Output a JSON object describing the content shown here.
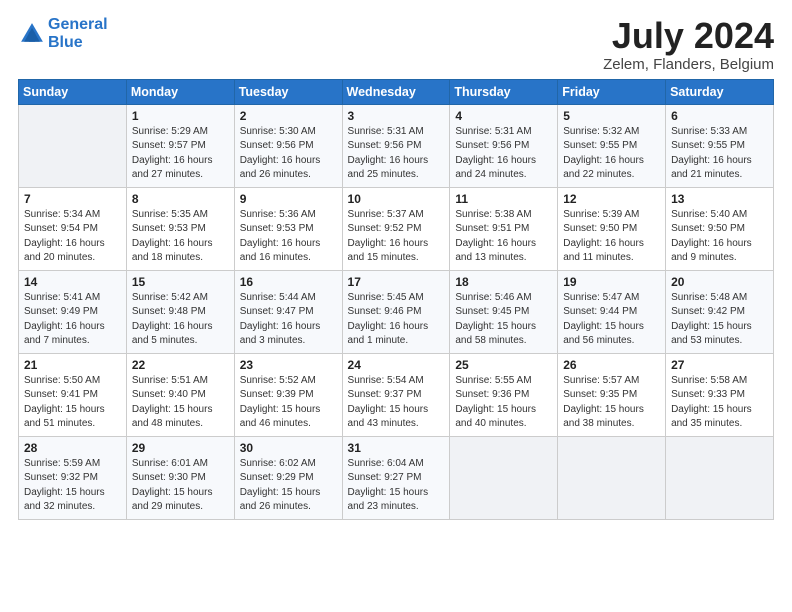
{
  "header": {
    "logo_line1": "General",
    "logo_line2": "Blue",
    "month_year": "July 2024",
    "location": "Zelem, Flanders, Belgium"
  },
  "weekdays": [
    "Sunday",
    "Monday",
    "Tuesday",
    "Wednesday",
    "Thursday",
    "Friday",
    "Saturday"
  ],
  "weeks": [
    [
      {
        "day": "",
        "text": ""
      },
      {
        "day": "1",
        "text": "Sunrise: 5:29 AM\nSunset: 9:57 PM\nDaylight: 16 hours\nand 27 minutes."
      },
      {
        "day": "2",
        "text": "Sunrise: 5:30 AM\nSunset: 9:56 PM\nDaylight: 16 hours\nand 26 minutes."
      },
      {
        "day": "3",
        "text": "Sunrise: 5:31 AM\nSunset: 9:56 PM\nDaylight: 16 hours\nand 25 minutes."
      },
      {
        "day": "4",
        "text": "Sunrise: 5:31 AM\nSunset: 9:56 PM\nDaylight: 16 hours\nand 24 minutes."
      },
      {
        "day": "5",
        "text": "Sunrise: 5:32 AM\nSunset: 9:55 PM\nDaylight: 16 hours\nand 22 minutes."
      },
      {
        "day": "6",
        "text": "Sunrise: 5:33 AM\nSunset: 9:55 PM\nDaylight: 16 hours\nand 21 minutes."
      }
    ],
    [
      {
        "day": "7",
        "text": "Sunrise: 5:34 AM\nSunset: 9:54 PM\nDaylight: 16 hours\nand 20 minutes."
      },
      {
        "day": "8",
        "text": "Sunrise: 5:35 AM\nSunset: 9:53 PM\nDaylight: 16 hours\nand 18 minutes."
      },
      {
        "day": "9",
        "text": "Sunrise: 5:36 AM\nSunset: 9:53 PM\nDaylight: 16 hours\nand 16 minutes."
      },
      {
        "day": "10",
        "text": "Sunrise: 5:37 AM\nSunset: 9:52 PM\nDaylight: 16 hours\nand 15 minutes."
      },
      {
        "day": "11",
        "text": "Sunrise: 5:38 AM\nSunset: 9:51 PM\nDaylight: 16 hours\nand 13 minutes."
      },
      {
        "day": "12",
        "text": "Sunrise: 5:39 AM\nSunset: 9:50 PM\nDaylight: 16 hours\nand 11 minutes."
      },
      {
        "day": "13",
        "text": "Sunrise: 5:40 AM\nSunset: 9:50 PM\nDaylight: 16 hours\nand 9 minutes."
      }
    ],
    [
      {
        "day": "14",
        "text": "Sunrise: 5:41 AM\nSunset: 9:49 PM\nDaylight: 16 hours\nand 7 minutes."
      },
      {
        "day": "15",
        "text": "Sunrise: 5:42 AM\nSunset: 9:48 PM\nDaylight: 16 hours\nand 5 minutes."
      },
      {
        "day": "16",
        "text": "Sunrise: 5:44 AM\nSunset: 9:47 PM\nDaylight: 16 hours\nand 3 minutes."
      },
      {
        "day": "17",
        "text": "Sunrise: 5:45 AM\nSunset: 9:46 PM\nDaylight: 16 hours\nand 1 minute."
      },
      {
        "day": "18",
        "text": "Sunrise: 5:46 AM\nSunset: 9:45 PM\nDaylight: 15 hours\nand 58 minutes."
      },
      {
        "day": "19",
        "text": "Sunrise: 5:47 AM\nSunset: 9:44 PM\nDaylight: 15 hours\nand 56 minutes."
      },
      {
        "day": "20",
        "text": "Sunrise: 5:48 AM\nSunset: 9:42 PM\nDaylight: 15 hours\nand 53 minutes."
      }
    ],
    [
      {
        "day": "21",
        "text": "Sunrise: 5:50 AM\nSunset: 9:41 PM\nDaylight: 15 hours\nand 51 minutes."
      },
      {
        "day": "22",
        "text": "Sunrise: 5:51 AM\nSunset: 9:40 PM\nDaylight: 15 hours\nand 48 minutes."
      },
      {
        "day": "23",
        "text": "Sunrise: 5:52 AM\nSunset: 9:39 PM\nDaylight: 15 hours\nand 46 minutes."
      },
      {
        "day": "24",
        "text": "Sunrise: 5:54 AM\nSunset: 9:37 PM\nDaylight: 15 hours\nand 43 minutes."
      },
      {
        "day": "25",
        "text": "Sunrise: 5:55 AM\nSunset: 9:36 PM\nDaylight: 15 hours\nand 40 minutes."
      },
      {
        "day": "26",
        "text": "Sunrise: 5:57 AM\nSunset: 9:35 PM\nDaylight: 15 hours\nand 38 minutes."
      },
      {
        "day": "27",
        "text": "Sunrise: 5:58 AM\nSunset: 9:33 PM\nDaylight: 15 hours\nand 35 minutes."
      }
    ],
    [
      {
        "day": "28",
        "text": "Sunrise: 5:59 AM\nSunset: 9:32 PM\nDaylight: 15 hours\nand 32 minutes."
      },
      {
        "day": "29",
        "text": "Sunrise: 6:01 AM\nSunset: 9:30 PM\nDaylight: 15 hours\nand 29 minutes."
      },
      {
        "day": "30",
        "text": "Sunrise: 6:02 AM\nSunset: 9:29 PM\nDaylight: 15 hours\nand 26 minutes."
      },
      {
        "day": "31",
        "text": "Sunrise: 6:04 AM\nSunset: 9:27 PM\nDaylight: 15 hours\nand 23 minutes."
      },
      {
        "day": "",
        "text": ""
      },
      {
        "day": "",
        "text": ""
      },
      {
        "day": "",
        "text": ""
      }
    ]
  ]
}
